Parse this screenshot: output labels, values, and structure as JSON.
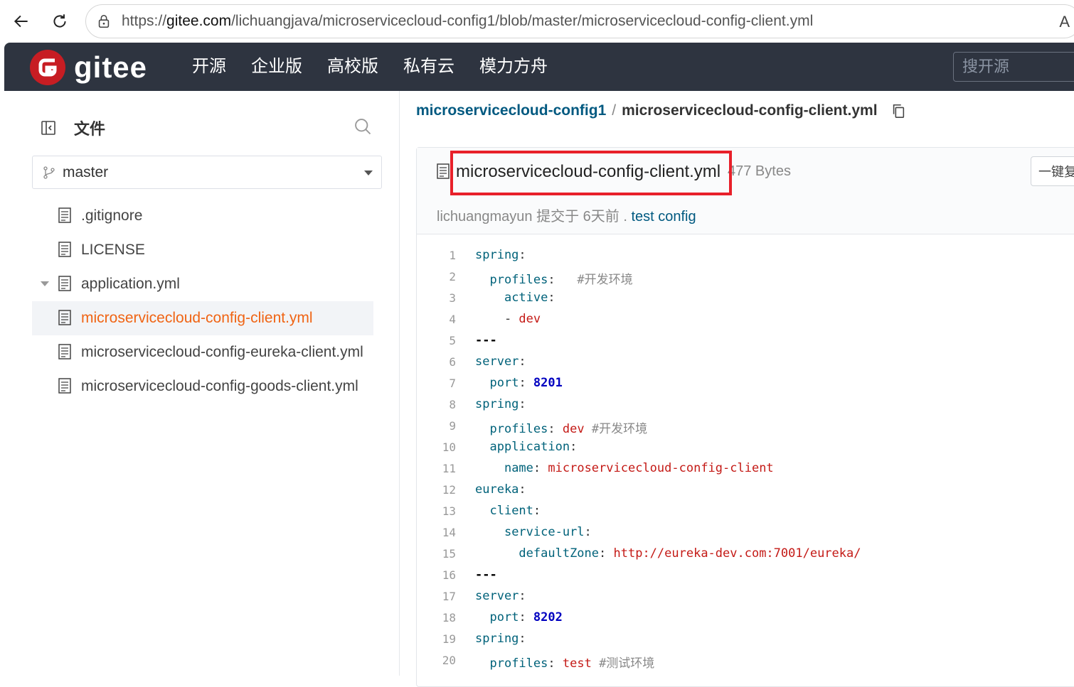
{
  "browser": {
    "url_prefix": "https://",
    "url_host": "gitee.com",
    "url_path": "/lichuangjava/microservicecloud-config1/blob/master/microservicecloud-config-client.yml",
    "read_aloud_icon": "A"
  },
  "header": {
    "logo_text": "gitee",
    "nav": [
      "开源",
      "企业版",
      "高校版",
      "私有云",
      "模力方舟"
    ],
    "search_placeholder": "搜开源"
  },
  "sidebar": {
    "title": "文件",
    "branch": "master",
    "files": [
      {
        "name": ".gitignore",
        "expanded": false,
        "active": false
      },
      {
        "name": "LICENSE",
        "expanded": false,
        "active": false
      },
      {
        "name": "application.yml",
        "expanded": true,
        "active": false
      },
      {
        "name": "microservicecloud-config-client.yml",
        "expanded": false,
        "active": true
      },
      {
        "name": "microservicecloud-config-eureka-client.yml",
        "expanded": false,
        "active": false
      },
      {
        "name": "microservicecloud-config-goods-client.yml",
        "expanded": false,
        "active": false
      }
    ]
  },
  "breadcrumb": {
    "repo": "microservicecloud-config1",
    "separator": "/",
    "file": "microservicecloud-config-client.yml"
  },
  "file": {
    "name": "microservicecloud-config-client.yml",
    "size": "477 Bytes",
    "author": "lichuangmayun",
    "commit_prefix": " 提交于 6天前 . ",
    "commit_message": "test config",
    "copy_all_label": "一键复制"
  },
  "code_lines": [
    [
      [
        "k",
        "spring"
      ],
      [
        "p",
        ":"
      ]
    ],
    [
      [
        "p",
        "  "
      ],
      [
        "k",
        "profiles"
      ],
      [
        "p",
        ":   "
      ],
      [
        "c",
        "#开发环境"
      ]
    ],
    [
      [
        "p",
        "    "
      ],
      [
        "k",
        "active"
      ],
      [
        "p",
        ":"
      ]
    ],
    [
      [
        "p",
        "    - "
      ],
      [
        "v",
        "dev"
      ]
    ],
    [
      [
        "d",
        "---"
      ]
    ],
    [
      [
        "k",
        "server"
      ],
      [
        "p",
        ":"
      ]
    ],
    [
      [
        "p",
        "  "
      ],
      [
        "k",
        "port"
      ],
      [
        "p",
        ": "
      ],
      [
        "n",
        "8201"
      ]
    ],
    [
      [
        "k",
        "spring"
      ],
      [
        "p",
        ":"
      ]
    ],
    [
      [
        "p",
        "  "
      ],
      [
        "k",
        "profiles"
      ],
      [
        "p",
        ": "
      ],
      [
        "v",
        "dev"
      ],
      [
        "p",
        " "
      ],
      [
        "c",
        "#开发环境"
      ]
    ],
    [
      [
        "p",
        "  "
      ],
      [
        "k",
        "application"
      ],
      [
        "p",
        ":"
      ]
    ],
    [
      [
        "p",
        "    "
      ],
      [
        "k",
        "name"
      ],
      [
        "p",
        ": "
      ],
      [
        "v",
        "microservicecloud-config-client"
      ]
    ],
    [
      [
        "k",
        "eureka"
      ],
      [
        "p",
        ":"
      ]
    ],
    [
      [
        "p",
        "  "
      ],
      [
        "k",
        "client"
      ],
      [
        "p",
        ":"
      ]
    ],
    [
      [
        "p",
        "    "
      ],
      [
        "k",
        "service-url"
      ],
      [
        "p",
        ":"
      ]
    ],
    [
      [
        "p",
        "      "
      ],
      [
        "k",
        "defaultZone"
      ],
      [
        "p",
        ": "
      ],
      [
        "v",
        "http://eureka-dev.com:7001/eureka/"
      ]
    ],
    [
      [
        "d",
        "---"
      ]
    ],
    [
      [
        "k",
        "server"
      ],
      [
        "p",
        ":"
      ]
    ],
    [
      [
        "p",
        "  "
      ],
      [
        "k",
        "port"
      ],
      [
        "p",
        ": "
      ],
      [
        "n",
        "8202"
      ]
    ],
    [
      [
        "k",
        "spring"
      ],
      [
        "p",
        ":"
      ]
    ],
    [
      [
        "p",
        "  "
      ],
      [
        "k",
        "profiles"
      ],
      [
        "p",
        ": "
      ],
      [
        "v",
        "test"
      ],
      [
        "p",
        " "
      ],
      [
        "c",
        "#测试环境"
      ]
    ]
  ]
}
